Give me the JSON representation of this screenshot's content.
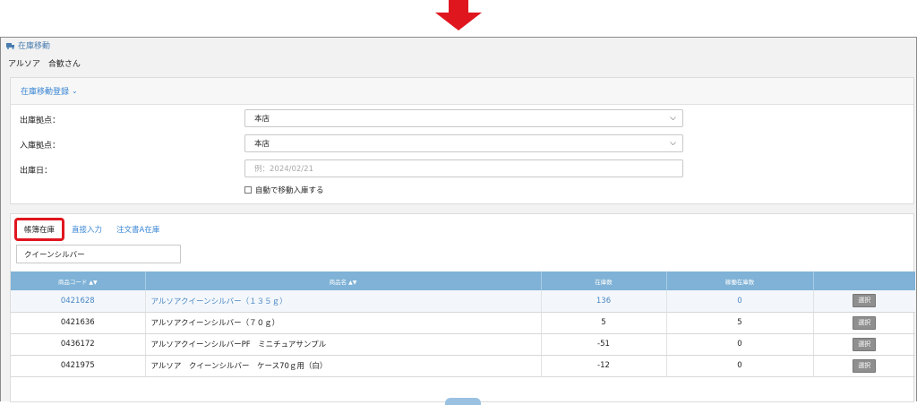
{
  "header": {
    "page_title": "在庫移動",
    "user": "アルソア　合歓さん"
  },
  "registration": {
    "title": "在庫移動登録",
    "from_label": "出庫拠点：",
    "from_value": "本店",
    "to_label": "入庫拠点：",
    "to_value": "本店",
    "date_label": "出庫日：",
    "date_placeholder": "例：2024/02/21",
    "auto_label": "自動で移動入庫する"
  },
  "tabs": [
    {
      "label": "帳簿在庫"
    },
    {
      "label": "直接入力"
    },
    {
      "label": "注文書A在庫"
    }
  ],
  "search": {
    "value": "クイーンシルバー"
  },
  "table": {
    "columns": [
      "商品コード",
      "商品名",
      "在庫数",
      "稼働在庫数",
      ""
    ],
    "button_label": "選択",
    "rows": [
      {
        "code": "0421628",
        "name": "アルソアクイーンシルバー（１３５ｇ）",
        "stock": "136",
        "active": "0"
      },
      {
        "code": "0421636",
        "name": "アルソアクイーンシルバー（７０ｇ）",
        "stock": "5",
        "active": "5"
      },
      {
        "code": "0436172",
        "name": "アルソアクイーンシルバーPF　ミニチュアサンプル",
        "stock": "-51",
        "active": "0"
      },
      {
        "code": "0421975",
        "name": "アルソア　クイーンシルバー　ケース70ｇ用（白）",
        "stock": "-12",
        "active": "0"
      }
    ]
  },
  "colors": {
    "accent": "#3a86d4",
    "header_row": "#7fb2d6",
    "highlight": "#e0161f"
  }
}
